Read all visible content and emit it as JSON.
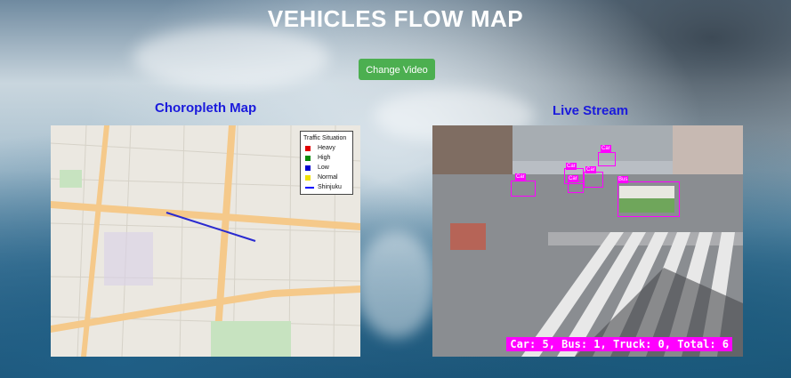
{
  "page": {
    "title": "VEHICLES FLOW MAP",
    "change_video_label": "Change Video"
  },
  "map_section": {
    "title": "Choropleth Map",
    "legend": {
      "title": "Traffic Situation",
      "items": [
        {
          "label": "Heavy",
          "color": "#e00000"
        },
        {
          "label": "High",
          "color": "#0a8a0a"
        },
        {
          "label": "Low",
          "color": "#0000d0"
        },
        {
          "label": "Normal",
          "color": "#f0e000"
        },
        {
          "label": "Shinjuku",
          "color": "#0000ff"
        }
      ]
    }
  },
  "stream_section": {
    "title": "Live Stream",
    "detections": [
      {
        "label": "Car"
      },
      {
        "label": "Car"
      },
      {
        "label": "Car"
      },
      {
        "label": "Car"
      },
      {
        "label": "Car"
      },
      {
        "label": "Bus"
      }
    ],
    "counter_text": "Car: 5, Bus: 1, Truck: 0, Total: 6"
  },
  "colors": {
    "title_blue": "#1a1adc",
    "button_green": "#4caf50",
    "detection_magenta": "#ff00ff"
  }
}
